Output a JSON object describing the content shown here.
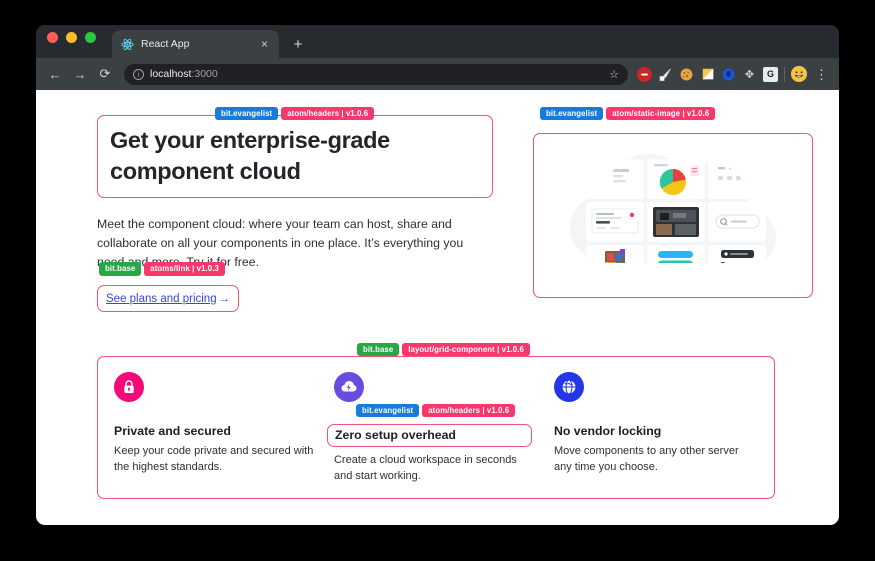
{
  "browser": {
    "tab": {
      "title": "React App",
      "favicon": "react-logo-icon",
      "close": "×"
    },
    "new_tab": "+",
    "nav": {
      "back": "←",
      "forward": "→",
      "reload": "⟳"
    },
    "omnibox": {
      "info_icon": "i",
      "host": "localhost",
      "port": ":3000",
      "star": "☆"
    },
    "extensions": [
      {
        "name": "ublock-origin-icon",
        "glyph": "",
        "color": "#c62828",
        "text_color": "#ffffff"
      },
      {
        "name": "pen-tool-icon",
        "glyph": "",
        "color": "#eceff1",
        "text_color": "#37474f"
      },
      {
        "name": "cookie-icon",
        "glyph": "",
        "color": "#e8a33d",
        "text_color": "#6b4a18"
      },
      {
        "name": "note-icon",
        "glyph": "",
        "color": "#f2c94c",
        "text_color": "#8a6d1a"
      },
      {
        "name": "pocket-icon",
        "glyph": "",
        "color": "#1a73e8",
        "text_color": "#ffffff"
      },
      {
        "name": "move-icon",
        "glyph": "✥",
        "color": "transparent",
        "text_color": "#cfd2d6"
      },
      {
        "name": "grammarly-icon",
        "glyph": "G",
        "color": "#e8eaed",
        "text_color": "#202124"
      }
    ],
    "profile_avatar": "smiley-avatar",
    "menu": "⋮"
  },
  "page": {
    "hero": {
      "headline_badge": {
        "owner": "bit.evangelist",
        "owner_color": "blue",
        "component": "atom/headers | v1.0.6"
      },
      "headline": "Get your enterprise-grade component cloud",
      "paragraph": "Meet the component cloud: where your team can host, share and collaborate on all your components in one place. It’s everything you need and more. Try it for free.",
      "link_badge": {
        "owner": "bit.base",
        "owner_color": "green",
        "component": "atoms/link | v1.0.3"
      },
      "link_label": "See plans and pricing",
      "link_arrow": "→",
      "image_badge": {
        "owner": "bit.evangelist",
        "owner_color": "blue",
        "component": "atom/static-image | v1.0.6"
      },
      "image_alt": "component-cloud-illustration"
    },
    "features": {
      "section_badge": {
        "owner": "bit.base",
        "owner_color": "green",
        "component": "layout/grid-component | v1.0.6"
      },
      "items": [
        {
          "icon": "lock-icon",
          "icon_color": "pink",
          "title": "Private and secured",
          "description": "Keep your code private and secured with the highest standards.",
          "boxed": false,
          "badge": null
        },
        {
          "icon": "cloud-bolt-icon",
          "icon_color": "purple",
          "title": "Zero setup overhead",
          "description": "Create a cloud workspace in seconds and start working.",
          "boxed": true,
          "badge": {
            "owner": "bit.evangelist",
            "owner_color": "blue",
            "component": "atom/headers | v1.0.6"
          }
        },
        {
          "icon": "globe-icon",
          "icon_color": "blue",
          "title": "No vendor locking",
          "description": "Move components to any other server any time you choose.",
          "boxed": false,
          "badge": null
        }
      ]
    }
  },
  "colors": {
    "bit_outline": "#f2527d",
    "tag_name": "#f8376d",
    "tag_owner_blue": "#187bdb",
    "tag_owner_green": "#28a745",
    "link": "#3b42e0"
  }
}
